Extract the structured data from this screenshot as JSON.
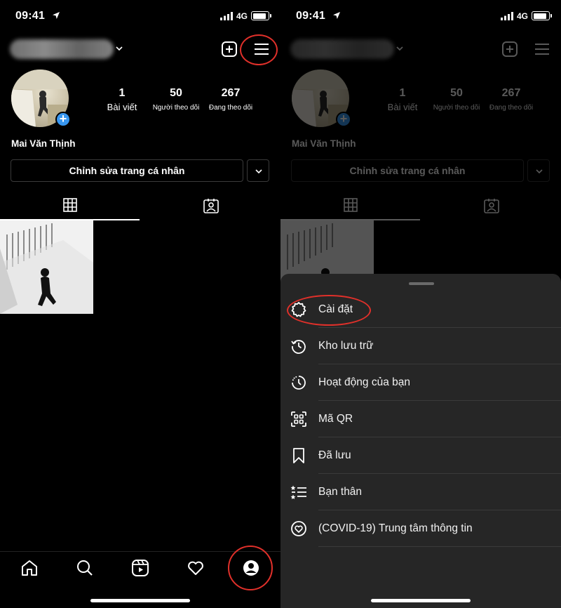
{
  "status_bar": {
    "time": "09:41",
    "network": "4G"
  },
  "profile": {
    "full_name": "Mai Văn Thịnh",
    "stats": [
      {
        "value": "1",
        "label": "Bài viết"
      },
      {
        "value": "50",
        "label": "Người theo dõi"
      },
      {
        "value": "267",
        "label": "Đang theo dõi"
      }
    ],
    "edit_button_label": "Chỉnh sửa trang cá nhân"
  },
  "bottom_nav": [
    "home-icon",
    "search-icon",
    "reels-icon",
    "heart-icon",
    "profile-icon"
  ],
  "menu_sheet": {
    "items": [
      {
        "label": "Cài đặt",
        "icon": "settings-gear-icon"
      },
      {
        "label": "Kho lưu trữ",
        "icon": "archive-history-icon"
      },
      {
        "label": "Hoạt động của bạn",
        "icon": "activity-clock-icon"
      },
      {
        "label": "Mã QR",
        "icon": "qr-code-icon"
      },
      {
        "label": "Đã lưu",
        "icon": "bookmark-icon"
      },
      {
        "label": "Bạn thân",
        "icon": "close-friends-list-icon"
      },
      {
        "label": "(COVID-19) Trung tâm thông tin",
        "icon": "covid-info-heart-icon"
      }
    ]
  },
  "colors": {
    "background": "#000000",
    "sheet": "#262626",
    "accent_blue": "#3897f0",
    "highlight_red": "#e0302a"
  }
}
